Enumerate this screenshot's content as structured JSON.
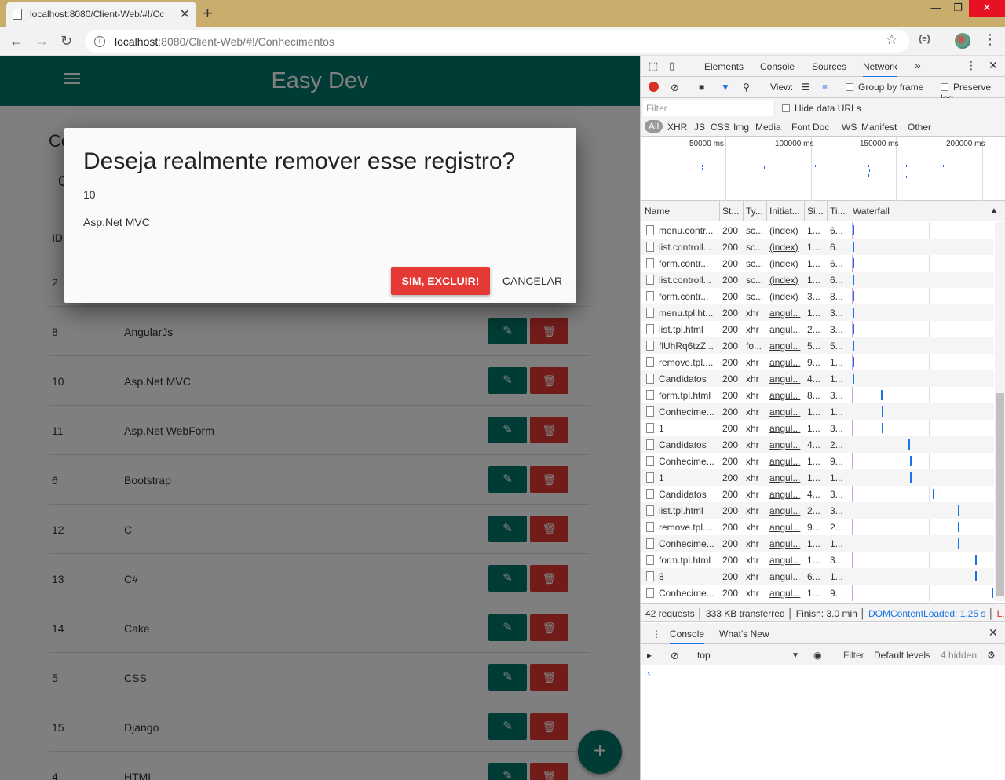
{
  "browser": {
    "tab_title": "localhost:8080/Client-Web/#!/Cc",
    "new_tab": "+",
    "url_host": "localhost",
    "url_path": ":8080/Client-Web/#!/Conhecimentos",
    "win_min": "—",
    "win_max": "❐",
    "win_close": "✕"
  },
  "app": {
    "brand": "Easy Dev",
    "page_heading": "Cc",
    "sub_heading": "C",
    "id_header": "ID",
    "rows": [
      {
        "id": "2",
        "name": ""
      },
      {
        "id": "8",
        "name": "AngularJs"
      },
      {
        "id": "10",
        "name": "Asp.Net MVC"
      },
      {
        "id": "11",
        "name": "Asp.Net WebForm"
      },
      {
        "id": "6",
        "name": "Bootstrap"
      },
      {
        "id": "12",
        "name": "C"
      },
      {
        "id": "13",
        "name": "C#"
      },
      {
        "id": "14",
        "name": "Cake"
      },
      {
        "id": "5",
        "name": "CSS"
      },
      {
        "id": "15",
        "name": "Django"
      },
      {
        "id": "4",
        "name": "HTML"
      }
    ],
    "fab": "+"
  },
  "dialog": {
    "title": "Deseja realmente remover esse registro?",
    "line1": "10",
    "line2": "Asp.Net MVC",
    "confirm": "SIM, EXCLUIR!",
    "cancel": "CANCELAR"
  },
  "devtools": {
    "tabs": [
      "Elements",
      "Console",
      "Sources",
      "Network"
    ],
    "more": "»",
    "view_label": "View:",
    "group_by_frame": "Group by frame",
    "preserve_log": "Preserve log",
    "filter_placeholder": "Filter",
    "hide_data_urls": "Hide data URLs",
    "types": [
      "All",
      "XHR",
      "JS",
      "CSS",
      "Img",
      "Media",
      "Font",
      "Doc",
      "WS",
      "Manifest",
      "Other"
    ],
    "ticks": [
      "50000 ms",
      "100000 ms",
      "150000 ms",
      "200000 ms"
    ],
    "columns": [
      "Name",
      "St...",
      "Ty...",
      "Initiat...",
      "Si...",
      "Ti...",
      "Waterfall"
    ],
    "requests": [
      {
        "name": "menu.contr...",
        "status": "200",
        "type": "sc...",
        "init": "(index)",
        "size": "1...",
        "time": "6...",
        "bar": 0.4
      },
      {
        "name": "list.controll...",
        "status": "200",
        "type": "sc...",
        "init": "(index)",
        "size": "1...",
        "time": "6...",
        "bar": 0.4
      },
      {
        "name": "form.contr...",
        "status": "200",
        "type": "sc...",
        "init": "(index)",
        "size": "1...",
        "time": "6...",
        "bar": 0.4
      },
      {
        "name": "list.controll...",
        "status": "200",
        "type": "sc...",
        "init": "(index)",
        "size": "1...",
        "time": "6...",
        "bar": 0.4
      },
      {
        "name": "form.contr...",
        "status": "200",
        "type": "sc...",
        "init": "(index)",
        "size": "3...",
        "time": "8...",
        "bar": 0.4
      },
      {
        "name": "menu.tpl.ht...",
        "status": "200",
        "type": "xhr",
        "init": "angul...",
        "size": "1...",
        "time": "3...",
        "bar": 0.4
      },
      {
        "name": "list.tpl.html",
        "status": "200",
        "type": "xhr",
        "init": "angul...",
        "size": "2...",
        "time": "3...",
        "bar": 0.4
      },
      {
        "name": "flUhRq6tzZ...",
        "status": "200",
        "type": "fo...",
        "init": "angul...",
        "size": "5...",
        "time": "5...",
        "bar": 0.4
      },
      {
        "name": "remove.tpl....",
        "status": "200",
        "type": "xhr",
        "init": "angul...",
        "size": "9...",
        "time": "1...",
        "bar": 0.4
      },
      {
        "name": "Candidatos",
        "status": "200",
        "type": "xhr",
        "init": "angul...",
        "size": "4...",
        "time": "1...",
        "bar": 0.4
      },
      {
        "name": "form.tpl.html",
        "status": "200",
        "type": "xhr",
        "init": "angul...",
        "size": "8...",
        "time": "3...",
        "bar": 36
      },
      {
        "name": "Conhecime...",
        "status": "200",
        "type": "xhr",
        "init": "angul...",
        "size": "1...",
        "time": "1...",
        "bar": 37
      },
      {
        "name": "1",
        "status": "200",
        "type": "xhr",
        "init": "angul...",
        "size": "1...",
        "time": "3...",
        "bar": 37
      },
      {
        "name": "Candidatos",
        "status": "200",
        "type": "xhr",
        "init": "angul...",
        "size": "4...",
        "time": "2...",
        "bar": 71
      },
      {
        "name": "Conhecime...",
        "status": "200",
        "type": "xhr",
        "init": "angul...",
        "size": "1...",
        "time": "9...",
        "bar": 73
      },
      {
        "name": "1",
        "status": "200",
        "type": "xhr",
        "init": "angul...",
        "size": "1...",
        "time": "1...",
        "bar": 73
      },
      {
        "name": "Candidatos",
        "status": "200",
        "type": "xhr",
        "init": "angul...",
        "size": "4...",
        "time": "3...",
        "bar": 102
      },
      {
        "name": "list.tpl.html",
        "status": "200",
        "type": "xhr",
        "init": "angul...",
        "size": "2...",
        "time": "3...",
        "bar": 134
      },
      {
        "name": "remove.tpl....",
        "status": "200",
        "type": "xhr",
        "init": "angul...",
        "size": "9...",
        "time": "2...",
        "bar": 134
      },
      {
        "name": "Conhecime...",
        "status": "200",
        "type": "xhr",
        "init": "angul...",
        "size": "1...",
        "time": "1...",
        "bar": 134
      },
      {
        "name": "form.tpl.html",
        "status": "200",
        "type": "xhr",
        "init": "angul...",
        "size": "1...",
        "time": "3...",
        "bar": 156
      },
      {
        "name": "8",
        "status": "200",
        "type": "xhr",
        "init": "angul...",
        "size": "6...",
        "time": "1...",
        "bar": 156
      },
      {
        "name": "Conhecime...",
        "status": "200",
        "type": "xhr",
        "init": "angul...",
        "size": "1...",
        "time": "9...",
        "bar": 177
      }
    ],
    "summary_requests": "42 requests",
    "summary_transferred": "333 KB transferred",
    "summary_finish": "Finish: 3.0 min",
    "summary_dcl": "DOMContentLoaded: 1.25 s",
    "summary_load": "L...",
    "drawer_console": "Console",
    "drawer_whats_new": "What's New",
    "context": "top",
    "console_filter": "Filter",
    "default_levels": "Default levels",
    "hidden_count": "4 hidden",
    "prompt": "›"
  }
}
